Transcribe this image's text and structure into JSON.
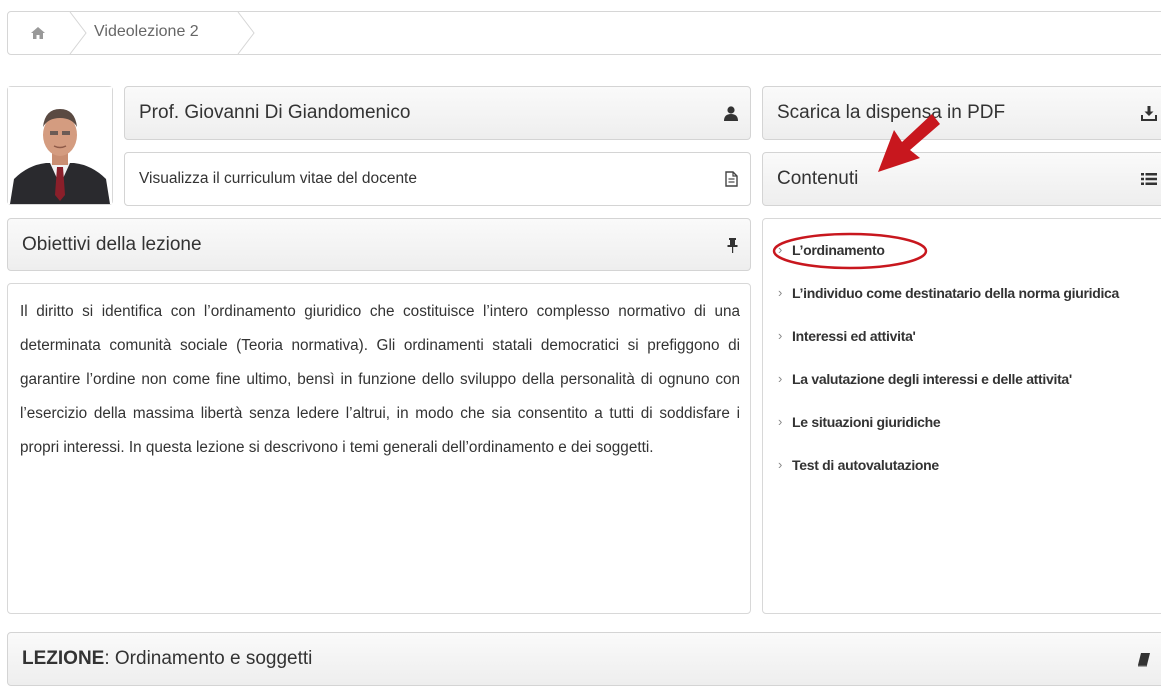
{
  "breadcrumb": {
    "home_icon": "home-icon",
    "current": "Videolezione 2"
  },
  "teacher": {
    "name": "Prof. Giovanni Di Giandomenico",
    "name_icon": "user-icon",
    "cv_link": "Visualizza il curriculum vitae del docente",
    "cv_icon": "document-icon"
  },
  "objectives": {
    "title": "Obiettivi della lezione",
    "title_icon": "pin-icon",
    "text": "Il diritto si identifica con l’ordinamento giuridico che costituisce l’intero complesso normativo di una determinata comunità sociale (Teoria normativa). Gli ordinamenti statali democratici si prefiggono di garantire l’ordine non come fine ultimo, bensì in funzione dello sviluppo della personalità di ognuno con l’esercizio della massima libertà senza ledere l’altrui, in modo che sia consentito a tutti di soddisfare i propri interessi. In questa lezione si descrivono i temi generali dell’ordinamento e dei soggetti."
  },
  "download": {
    "label": "Scarica la dispensa in PDF",
    "icon": "download-icon"
  },
  "contents": {
    "title": "Contenuti",
    "icon": "list-icon",
    "items": [
      "L’ordinamento",
      "L’individuo come destinatario della norma giuridica",
      "Interessi ed attivita'",
      "La valutazione degli interessi e delle attivita'",
      "Le situazioni giuridiche",
      "Test di autovalutazione"
    ]
  },
  "lesson": {
    "prefix": "LEZIONE",
    "title": ": Ordinamento e soggetti",
    "icon": "book-icon"
  },
  "colors": {
    "annotation_red": "#c8171e",
    "bar_bg": "#eeeeee",
    "border": "#d6d6d6"
  }
}
